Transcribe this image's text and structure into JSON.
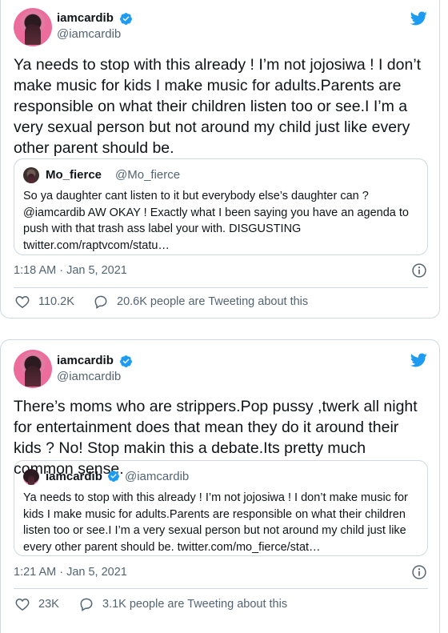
{
  "tweets": [
    {
      "author_name": "iamcardib",
      "author_handle": "@iamcardib",
      "text": "Ya needs to stop with this already ! I’m not jojosiwa ! I don’t make music for kids I make music for adults.Parents are responsible on what their children listen too or see.I I’m a very sexual person but not around my child just like every other parent should be.",
      "quote": {
        "author_name": "Mo_fierce",
        "author_handle": "@Mo_fierce",
        "text": "So ya daughter cant listen to it but everybody else’s daughter can ? @iamcardib AW OKAY ! Exactly what I been saying you have an agenda to push with that trash ass label your with. DISGUSTING twitter.com/raptvcom/statu…"
      },
      "time": "1:18 AM · Jan 5, 2021",
      "likes": "110.2K",
      "tweeting": "20.6K people are Tweeting about this"
    },
    {
      "author_name": "iamcardib",
      "author_handle": "@iamcardib",
      "text": "There’s moms who are strippers.Pop pussy ,twerk all night for entertainment does that mean they do it around their kids ? No! Stop makin this a debate.Its pretty much common sense.",
      "quote": {
        "author_name": "iamcardib",
        "author_handle": "@iamcardib",
        "text": "Ya needs to stop with this already ! I’m not jojosiwa ! I don’t make music for kids I make music for adults.Parents are responsible on what their children listen too or see.I I’m a very sexual person but not around my child just like every other parent should be. twitter.com/mo_fierce/stat…"
      },
      "time": "1:21 AM · Jan 5, 2021",
      "likes": "23K",
      "tweeting": "3.1K people are Tweeting about this"
    }
  ],
  "colors": {
    "twitter_blue": "#1d9bf0",
    "secondary_text": "#536471",
    "border": "#cfd9de"
  },
  "icons": [
    "twitter-bird-icon",
    "verified-badge-icon",
    "info-icon",
    "heart-icon",
    "comment-bubble-icon"
  ]
}
